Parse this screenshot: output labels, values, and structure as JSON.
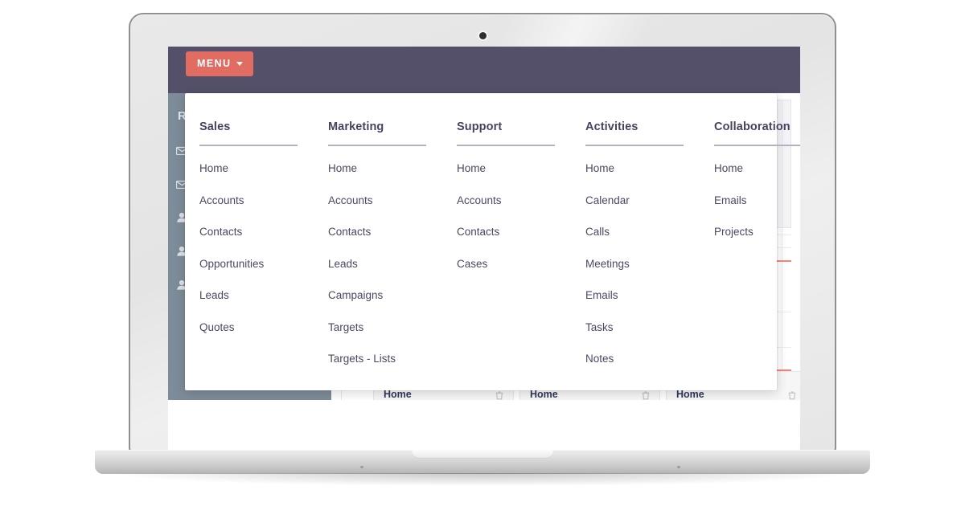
{
  "app": {
    "topbar": {
      "menu_button_label": "MENU",
      "menu_button_color": "#e06c62",
      "bar_color": "#54506a"
    },
    "sidebar": {
      "color": "#7d8c99",
      "title": "R",
      "rows": [
        {
          "icon": "envelope-icon",
          "label": ""
        },
        {
          "icon": "envelope-icon",
          "label": ""
        },
        {
          "icon": "person-icon",
          "label": ""
        },
        {
          "icon": "person-icon",
          "label": ""
        },
        {
          "icon": "person-icon",
          "label": ""
        }
      ]
    },
    "content": {
      "accent_line_color": "#f4857e",
      "cards": [
        {
          "label": "Home",
          "icon": "trash-icon"
        },
        {
          "label": "Home",
          "icon": "trash-icon"
        },
        {
          "label": "Home",
          "icon": "trash-icon"
        }
      ]
    }
  },
  "megamenu": {
    "columns": [
      {
        "title": "Sales",
        "items": [
          "Home",
          "Accounts",
          "Contacts",
          "Opportunities",
          "Leads",
          "Quotes"
        ]
      },
      {
        "title": "Marketing",
        "items": [
          "Home",
          "Accounts",
          "Contacts",
          "Leads",
          "Campaigns",
          "Targets",
          "Targets - Lists"
        ]
      },
      {
        "title": "Support",
        "items": [
          "Home",
          "Accounts",
          "Contacts",
          "Cases"
        ]
      },
      {
        "title": "Activities",
        "items": [
          "Home",
          "Calendar",
          "Calls",
          "Meetings",
          "Emails",
          "Tasks",
          "Notes"
        ]
      },
      {
        "title": "Collaboration",
        "items": [
          "Home",
          "Emails",
          "Projects"
        ]
      }
    ]
  }
}
